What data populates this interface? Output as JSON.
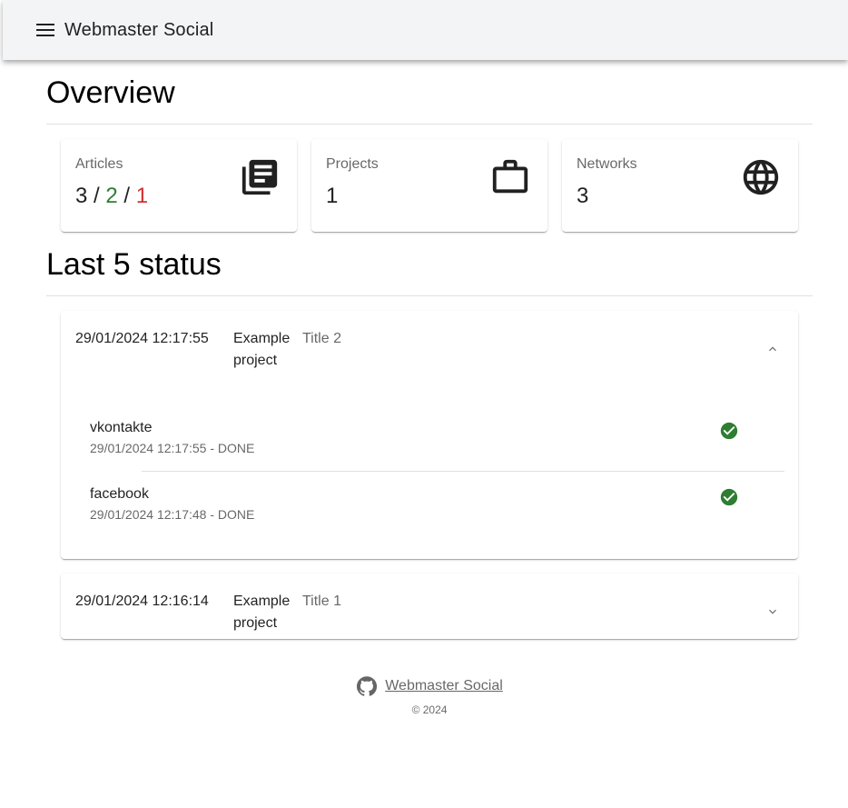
{
  "appbar": {
    "title": "Webmaster Social",
    "menu_icon": "menu-icon"
  },
  "overview": {
    "title": "Overview",
    "cards": [
      {
        "label": "Articles",
        "total": "3",
        "separator": " / ",
        "done": "2",
        "failed": "1",
        "icon": "newspaper-icon"
      },
      {
        "label": "Projects",
        "value": "1",
        "icon": "briefcase-icon"
      },
      {
        "label": "Networks",
        "value": "3",
        "icon": "globe-icon"
      }
    ]
  },
  "status": {
    "title": "Last 5 status",
    "items": [
      {
        "date": "29/01/2024 12:17:55",
        "project": "Example project",
        "title": "Title 2",
        "expanded": true,
        "networks": [
          {
            "name": "vkontakte",
            "detail": "29/01/2024 12:17:55 - DONE"
          },
          {
            "name": "facebook",
            "detail": "29/01/2024 12:17:48 - DONE"
          }
        ]
      },
      {
        "date": "29/01/2024 12:16:14",
        "project": "Example project",
        "title": "Title 1",
        "expanded": false
      }
    ]
  },
  "footer": {
    "link": "Webmaster Social",
    "copyright": "© 2024"
  },
  "colors": {
    "success": "#2e7d32",
    "error": "#d32f2f",
    "appbar": "#f3f4f6"
  }
}
